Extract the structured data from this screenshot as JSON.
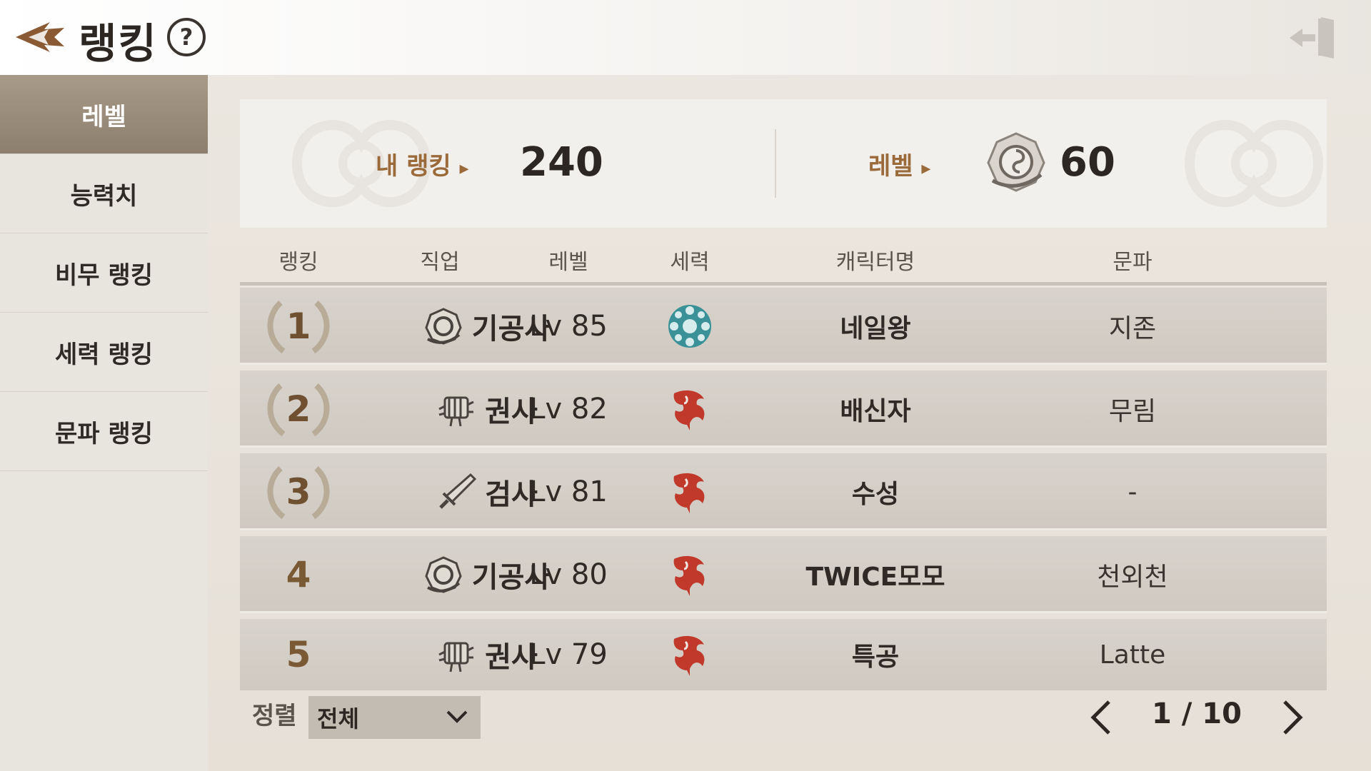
{
  "header": {
    "title": "랭킹",
    "help_label": "?"
  },
  "sidebar": {
    "items": [
      {
        "label": "레벨",
        "active": true
      },
      {
        "label": "능력치",
        "active": false
      },
      {
        "label": "비무 랭킹",
        "active": false
      },
      {
        "label": "세력 랭킹",
        "active": false
      },
      {
        "label": "문파 랭킹",
        "active": false
      }
    ]
  },
  "summary": {
    "my_rank_label": "내 랭킹",
    "my_rank_value": "240",
    "level_label": "레벨",
    "level_value": "60"
  },
  "table": {
    "headers": [
      "랭킹",
      "직업",
      "레벨",
      "세력",
      "캐릭터명",
      "문파"
    ],
    "rows": [
      {
        "rank": "1",
        "job": "기공사",
        "job_icon": "qigong-icon",
        "level": "Lv 85",
        "faction_icon": "snowflake-faction-icon",
        "name": "네일왕",
        "guild": "지존"
      },
      {
        "rank": "2",
        "job": "권사",
        "job_icon": "fist-icon",
        "level": "Lv 82",
        "faction_icon": "red-beast-faction-icon",
        "name": "배신자",
        "guild": "무림"
      },
      {
        "rank": "3",
        "job": "검사",
        "job_icon": "sword-icon",
        "level": "Lv 81",
        "faction_icon": "red-beast-faction-icon",
        "name": "수성",
        "guild": "-"
      },
      {
        "rank": "4",
        "job": "기공사",
        "job_icon": "qigong-icon",
        "level": "Lv 80",
        "faction_icon": "red-beast-faction-icon",
        "name": "TWICE모모",
        "guild": "천외천"
      },
      {
        "rank": "5",
        "job": "권사",
        "job_icon": "fist-icon",
        "level": "Lv 79",
        "faction_icon": "red-beast-faction-icon",
        "name": "특공",
        "guild": "Latte"
      }
    ]
  },
  "footer": {
    "sort_label": "정렬",
    "sort_value": "전체",
    "page_text": "1 / 10"
  },
  "colors": {
    "accent_brown": "#9a6a3a",
    "sidebar_active": "#8d7f6e",
    "faction_teal": "#2e8a8f",
    "faction_red": "#c0392b"
  }
}
